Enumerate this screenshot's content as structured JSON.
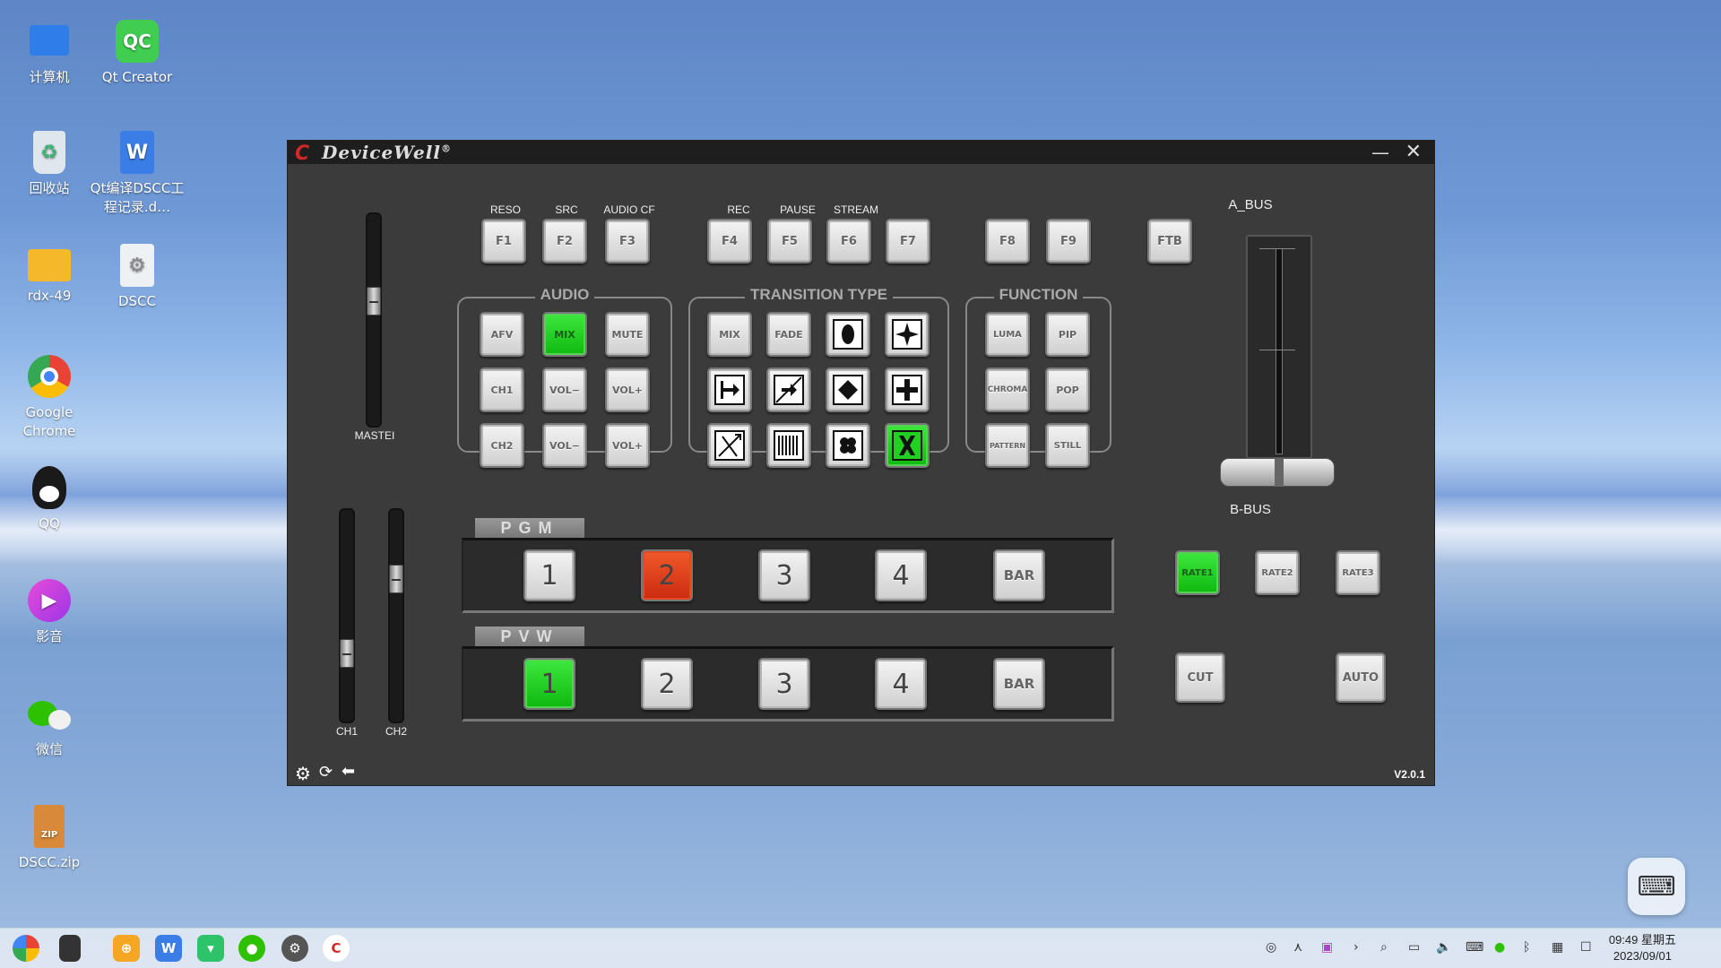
{
  "desktop": {
    "icons": [
      {
        "label": "计算机",
        "glyph": "▭",
        "color": "#2e7de8"
      },
      {
        "label": "Qt Creator",
        "glyph": "QC",
        "color": "#41cd52"
      },
      {
        "label": "回收站",
        "glyph": "♻",
        "color": "#d0dbe6"
      },
      {
        "label": "Qt编译DSCC工程记录.d…",
        "glyph": "W",
        "color": "#3b7de6"
      },
      {
        "label": "rdx-49",
        "glyph": "",
        "color": "#f5b82a"
      },
      {
        "label": "DSCC",
        "glyph": "⚙",
        "color": "#e8ecf0"
      },
      {
        "label": "Google Chrome",
        "glyph": "◉",
        "color": "#e84335"
      },
      {
        "label": "QQ",
        "glyph": "🐧",
        "color": "#111111"
      },
      {
        "label": "影音",
        "glyph": "▶",
        "color": "#d43ad8"
      },
      {
        "label": "微信",
        "glyph": "💬",
        "color": "#2dc100"
      },
      {
        "label": "DSCC.zip",
        "glyph": "ZIP",
        "color": "#d8893a"
      }
    ]
  },
  "window": {
    "logo": "C",
    "brand": "DeviceWell",
    "brand_mark": "®",
    "minimize": "—",
    "close": "✕",
    "version": "V2.0.1"
  },
  "fkeys": {
    "labels": [
      "RESO",
      "SRC",
      "AUDIO CF",
      "REC",
      "PAUSE",
      "STREAM"
    ],
    "keys": [
      "F1",
      "F2",
      "F3",
      "F4",
      "F5",
      "F6",
      "F7",
      "F8",
      "F9",
      "FTB"
    ]
  },
  "audio": {
    "title": "AUDIO",
    "buttons": [
      "AFV",
      "MIX",
      "MUTE",
      "CH1",
      "VOL−",
      "VOL+",
      "CH2",
      "VOL−",
      "VOL+"
    ]
  },
  "transition": {
    "title": "TRANSITION TYPE",
    "buttons": [
      "MIX",
      "FADE"
    ]
  },
  "function": {
    "title": "FUNCTION",
    "buttons": [
      "LUMA",
      "PIP",
      "CHROMA",
      "POP",
      "PATTERN",
      "STILL"
    ]
  },
  "faders": {
    "master": "MASTEI",
    "ch1": "CH1",
    "ch2": "CH2",
    "a_bus": "A_BUS",
    "b_bus": "B-BUS"
  },
  "pgm": {
    "title": "PGM",
    "buttons": [
      "1",
      "2",
      "3",
      "4",
      "BAR"
    ]
  },
  "pvw": {
    "title": "PVW",
    "buttons": [
      "1",
      "2",
      "3",
      "4",
      "BAR"
    ]
  },
  "rates": [
    "RATE1",
    "RATE2",
    "RATE3"
  ],
  "cut": "CUT",
  "auto": "AUTO",
  "taskbar": {
    "clock_time": "09:49 星期五",
    "clock_date": "2023/09/01"
  },
  "colors": {
    "active_green": "#22d022",
    "active_red": "#e03a1a"
  }
}
